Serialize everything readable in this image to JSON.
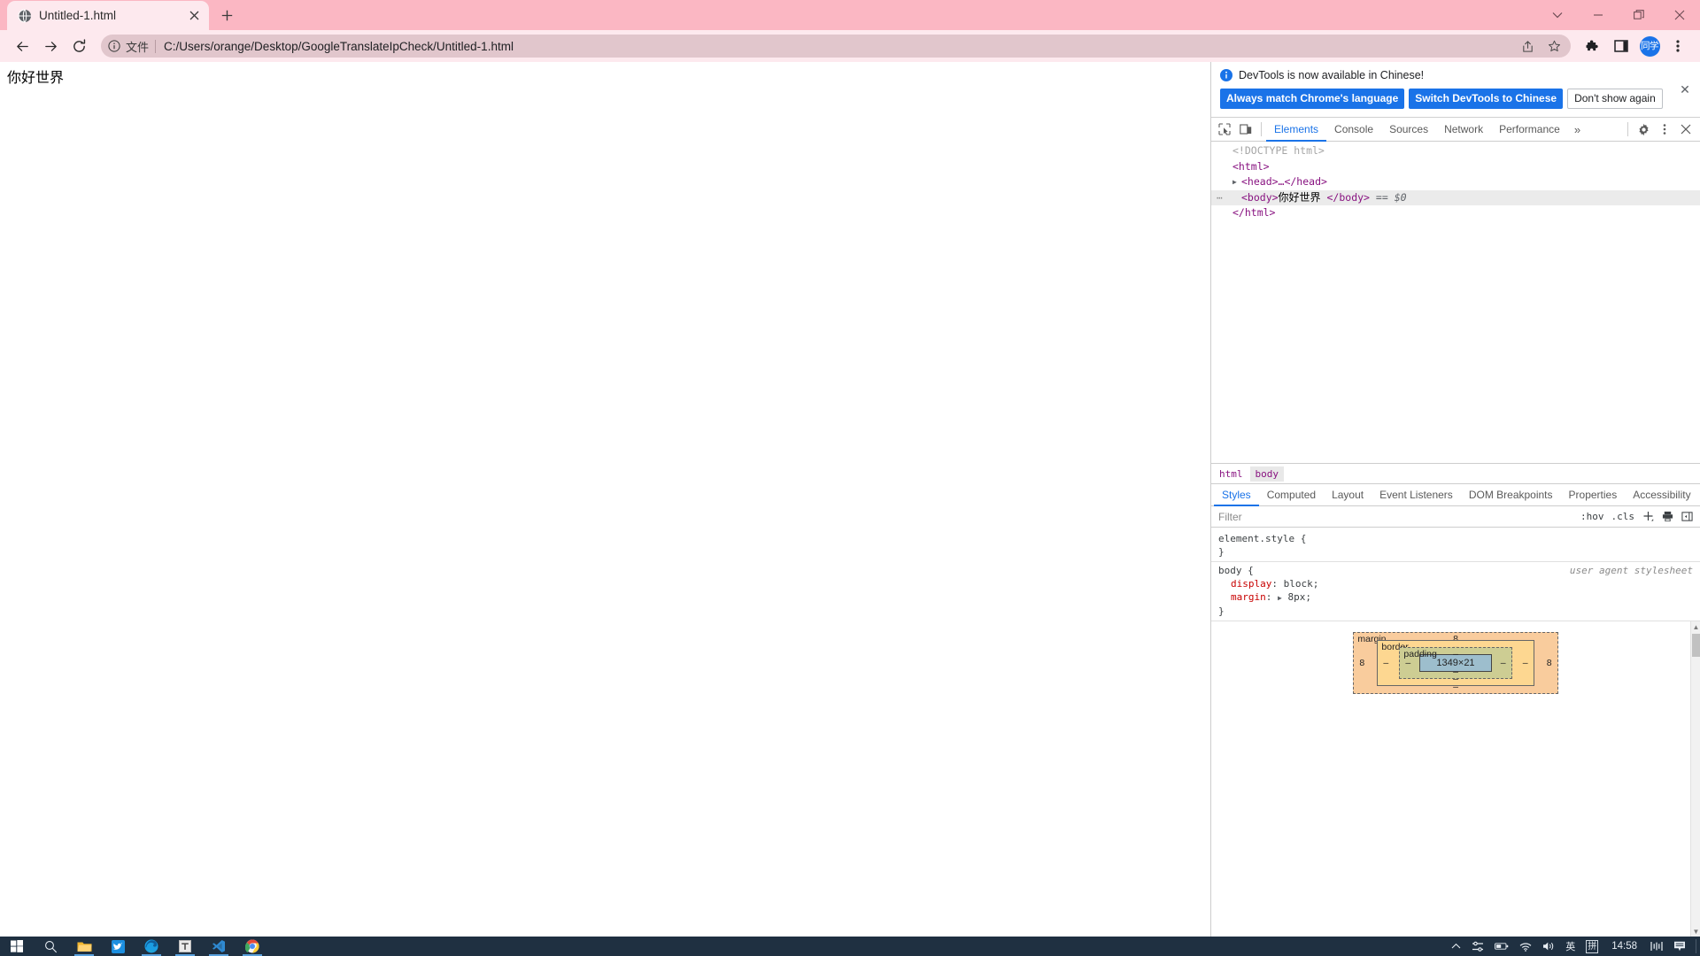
{
  "window": {
    "controls": [
      {
        "name": "tab-search-button",
        "glyph": "⌄"
      },
      {
        "name": "minimize-button",
        "glyph": "—"
      },
      {
        "name": "maximize-button",
        "glyph": "❐"
      },
      {
        "name": "close-button",
        "glyph": "✕"
      }
    ]
  },
  "tabstrip": {
    "tabs": [
      {
        "title": "Untitled-1.html",
        "favicon": "globe-icon",
        "close_glyph": "✕"
      }
    ],
    "new_tab_label": "+",
    "theme_color": "#fbb7c3"
  },
  "toolbar": {
    "back_label": "←",
    "forward_label": "→",
    "reload_label": "⟳",
    "omnibox": {
      "info_icon": "info-circle-icon",
      "scheme_label": "文件",
      "url": "C:/Users/orange/Desktop/GoogleTranslateIpCheck/Untitled-1.html",
      "share_icon": "share-icon",
      "bookmark_icon": "star-icon"
    },
    "extensions_icon": "puzzle-icon",
    "side_panel_icon": "side-panel-icon",
    "avatar_label": "同学",
    "avatar_color": "#1a73e8",
    "menu_icon": "three-dot-menu-icon"
  },
  "page": {
    "body_text": "你好世界"
  },
  "devtools": {
    "banner": {
      "info_icon": "info-icon",
      "message": "DevTools is now available in Chinese!",
      "primary_button": "Always match Chrome's language",
      "secondary_button": "Switch DevTools to Chinese",
      "tertiary_button": "Don't show again",
      "close_glyph": "✕",
      "accent_color": "#1a73e8"
    },
    "toolbar_icons": [
      {
        "name": "inspect-element-icon"
      },
      {
        "name": "device-toolbar-icon"
      }
    ],
    "tabs": [
      {
        "label": "Elements",
        "active": true
      },
      {
        "label": "Console",
        "active": false
      },
      {
        "label": "Sources",
        "active": false
      },
      {
        "label": "Network",
        "active": false
      },
      {
        "label": "Performance",
        "active": false
      }
    ],
    "overflow_label": "»",
    "settings_icon": "gear-icon",
    "kebab_icon": "three-dot-menu-icon",
    "close_glyph": "✕",
    "dom": {
      "rows": [
        {
          "indent": 0,
          "arrow": "",
          "kind": "doctype",
          "text": "<!DOCTYPE html>",
          "selected": false,
          "gutter": ""
        },
        {
          "indent": 0,
          "arrow": "",
          "kind": "tag",
          "text": "<html>",
          "selected": false,
          "gutter": ""
        },
        {
          "indent": 1,
          "arrow": "▶",
          "kind": "tag",
          "text": "<head>…</head>",
          "selected": false,
          "gutter": ""
        },
        {
          "indent": 1,
          "arrow": "",
          "kind": "body",
          "open_tag": "<body>",
          "inner_text": "你好世界",
          "close_tag": "</body>",
          "suffix_eq": "==",
          "suffix_var": "$0",
          "selected": true,
          "gutter": "⋯"
        },
        {
          "indent": 0,
          "arrow": "",
          "kind": "tag",
          "text": "</html>",
          "selected": false,
          "gutter": ""
        }
      ]
    },
    "breadcrumb": [
      {
        "label": "html",
        "selected": false
      },
      {
        "label": "body",
        "selected": true
      }
    ],
    "sidebar_tabs": [
      {
        "label": "Styles",
        "active": true
      },
      {
        "label": "Computed",
        "active": false
      },
      {
        "label": "Layout",
        "active": false
      },
      {
        "label": "Event Listeners",
        "active": false
      },
      {
        "label": "DOM Breakpoints",
        "active": false
      },
      {
        "label": "Properties",
        "active": false
      },
      {
        "label": "Accessibility",
        "active": false
      }
    ],
    "filter": {
      "placeholder": "Filter",
      "value": "",
      "hov_label": ":hov",
      "cls_label": ".cls",
      "new_rule_label": "+",
      "print_icon": "print-media-icon",
      "sidebar_toggle_icon": "computed-sidebar-icon"
    },
    "styles_rules": [
      {
        "selector": "element.style {",
        "origin": "",
        "properties": [],
        "closing": "}"
      },
      {
        "selector": "body {",
        "origin": "user agent stylesheet",
        "properties": [
          {
            "name": "display",
            "value": "block",
            "expandable": false
          },
          {
            "name": "margin",
            "value": "8px",
            "expandable": true
          }
        ],
        "closing": "}"
      }
    ],
    "box_model": {
      "margin_label": "margin",
      "margin_top": "8",
      "margin_right": "8",
      "margin_bottom": "–",
      "margin_left": "8",
      "border_label": "border",
      "border_top": "–",
      "border_right": "–",
      "border_bottom": "–",
      "border_left": "–",
      "padding_label": "padding",
      "padding_top": "–",
      "padding_right": "–",
      "padding_bottom": "–",
      "padding_left": "–",
      "content_size": "1349×21"
    }
  },
  "taskbar": {
    "items": [
      {
        "name": "start-button",
        "icon": "windows-logo-icon",
        "running": false
      },
      {
        "name": "search-button",
        "icon": "search-icon",
        "running": false
      },
      {
        "name": "file-explorer-button",
        "icon": "folder-icon",
        "running": true
      },
      {
        "name": "bird-app-button",
        "icon": "bird-icon",
        "running": false
      },
      {
        "name": "edge-button",
        "icon": "edge-icon",
        "running": true
      },
      {
        "name": "typora-button",
        "icon": "typora-t-icon",
        "running": true
      },
      {
        "name": "vscode-button",
        "icon": "vscode-icon",
        "running": true
      },
      {
        "name": "chrome-button",
        "icon": "chrome-icon",
        "running": true
      }
    ],
    "tray": [
      {
        "name": "show-hidden-icons",
        "glyph": "∧"
      },
      {
        "name": "network-settings-icon",
        "glyph": ""
      },
      {
        "name": "battery-icon",
        "glyph": ""
      },
      {
        "name": "wifi-icon",
        "glyph": ""
      },
      {
        "name": "volume-icon",
        "glyph": ""
      },
      {
        "name": "ime-language-indicator",
        "glyph": "英"
      },
      {
        "name": "ime-pinyin-indicator",
        "glyph": "拼"
      }
    ],
    "clock": "14:58",
    "audio_meter_icon": "audio-meter-icon",
    "notification_icon": "notification-icon"
  }
}
